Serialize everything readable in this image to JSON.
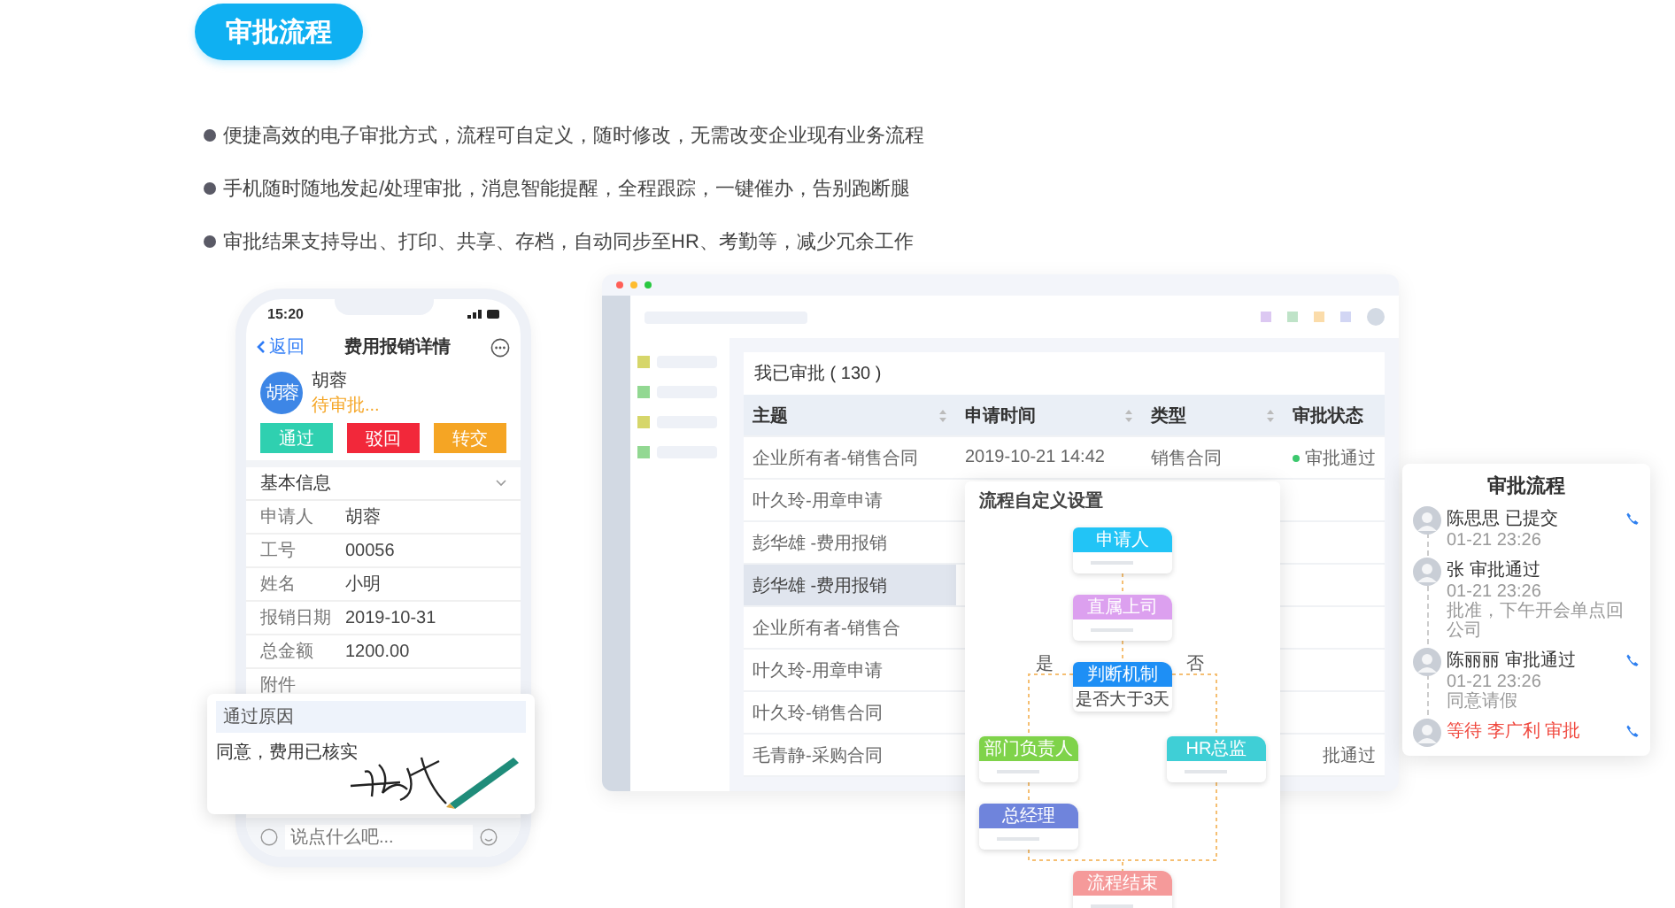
{
  "badge": "审批流程",
  "features": [
    "便捷高效的电子审批方式，流程可自定义，随时修改，无需改变企业现有业务流程",
    "手机随时随地发起/处理审批，消息智能提醒，全程跟踪，一键催办，告别跑断腿",
    "审批结果支持导出、打印、共享、存档，自动同步至HR、考勤等，减少冗余工作"
  ],
  "phone": {
    "time": "15:20",
    "back": "返回",
    "title": "费用报销详情",
    "user": {
      "avatar": "胡蓉",
      "name": "胡蓉",
      "status": "待审批..."
    },
    "actions": [
      {
        "label": "通过",
        "color": "#2fd0b0"
      },
      {
        "label": "驳回",
        "color": "#f2283a"
      },
      {
        "label": "转交",
        "color": "#f5a524"
      }
    ],
    "section": "基本信息",
    "fields": [
      {
        "label": "申请人",
        "value": "胡蓉"
      },
      {
        "label": "工号",
        "value": "00056"
      },
      {
        "label": "姓名",
        "value": "小明"
      },
      {
        "label": "报销日期",
        "value": "2019-10-31"
      },
      {
        "label": "总金额",
        "value": "1200.00"
      },
      {
        "label": "附件"
      }
    ],
    "popup": {
      "title": "通过原因",
      "text": "同意，费用已核实"
    },
    "input": {
      "placeholder": "说点什么吧..."
    }
  },
  "desktop": {
    "sidebar": [
      {
        "color": "#d6d66a"
      },
      {
        "color": "#92d892"
      },
      {
        "color": "#d6d66a"
      },
      {
        "color": "#92d892"
      }
    ],
    "toolbar": [
      {
        "color": "#dcc8f2"
      },
      {
        "color": "#bfe3c8"
      },
      {
        "color": "#fbdcaa"
      },
      {
        "color": "#d2d6f4"
      }
    ],
    "table_title": "我已审批 ( 130 )",
    "columns": [
      {
        "label": "主题",
        "sortable": true
      },
      {
        "label": "申请时间",
        "sortable": true
      },
      {
        "label": "类型",
        "sortable": true
      },
      {
        "label": "审批状态",
        "sortable": false
      }
    ],
    "rows": [
      {
        "subject": "企业所有者-销售合同",
        "time": "2019-10-21 14:42",
        "type": "销售合同",
        "status": "审批通过",
        "color": "#3cc86e",
        "selected": false
      },
      {
        "subject": "叶久玲-用章申请",
        "selected": false
      },
      {
        "subject": "彭华雄 -费用报销",
        "selected": false
      },
      {
        "subject": "彭华雄 -费用报销",
        "selected": true
      },
      {
        "subject": "企业所有者-销售合",
        "selected": false
      },
      {
        "subject": "叶久玲-用章申请",
        "selected": false
      },
      {
        "subject": "叶久玲-销售合同",
        "selected": false
      },
      {
        "subject": "毛青静-采购合同",
        "status": "批通过",
        "selected": false
      }
    ]
  },
  "flow": {
    "title": "流程自定义设置",
    "yes": "是",
    "no": "否",
    "nodes": [
      {
        "kind": "step",
        "label": "申请人",
        "color": "#22c4f6"
      },
      {
        "kind": "step",
        "label": "直属上司",
        "color": "#dca0ef"
      },
      {
        "kind": "decision",
        "label": "判断机制",
        "condition": "是否大于3天",
        "color": "#1e8ff5"
      },
      {
        "kind": "step",
        "label": "部门负责人",
        "color": "#7fd34a"
      },
      {
        "kind": "step",
        "label": "HR总监",
        "color": "#3fcfd6"
      },
      {
        "kind": "step",
        "label": "总经理",
        "color": "#6f84dc"
      },
      {
        "kind": "step",
        "label": "流程结束",
        "color": "#f59a9a"
      }
    ]
  },
  "approval": {
    "title": "审批流程",
    "steps": [
      {
        "kind": "done",
        "name": "陈思思 已提交",
        "time": "01-21 23:26",
        "call": true
      },
      {
        "kind": "done",
        "name": "张 审批通过",
        "time": "01-21 23:26",
        "note": "批准，下午开会单点回公司",
        "call": false
      },
      {
        "kind": "done",
        "name": "陈丽丽 审批通过",
        "time": "01-21 23:26",
        "note": "同意请假",
        "call": true
      },
      {
        "kind": "pending",
        "name": "等待 李广利 审批",
        "call": true
      }
    ]
  }
}
